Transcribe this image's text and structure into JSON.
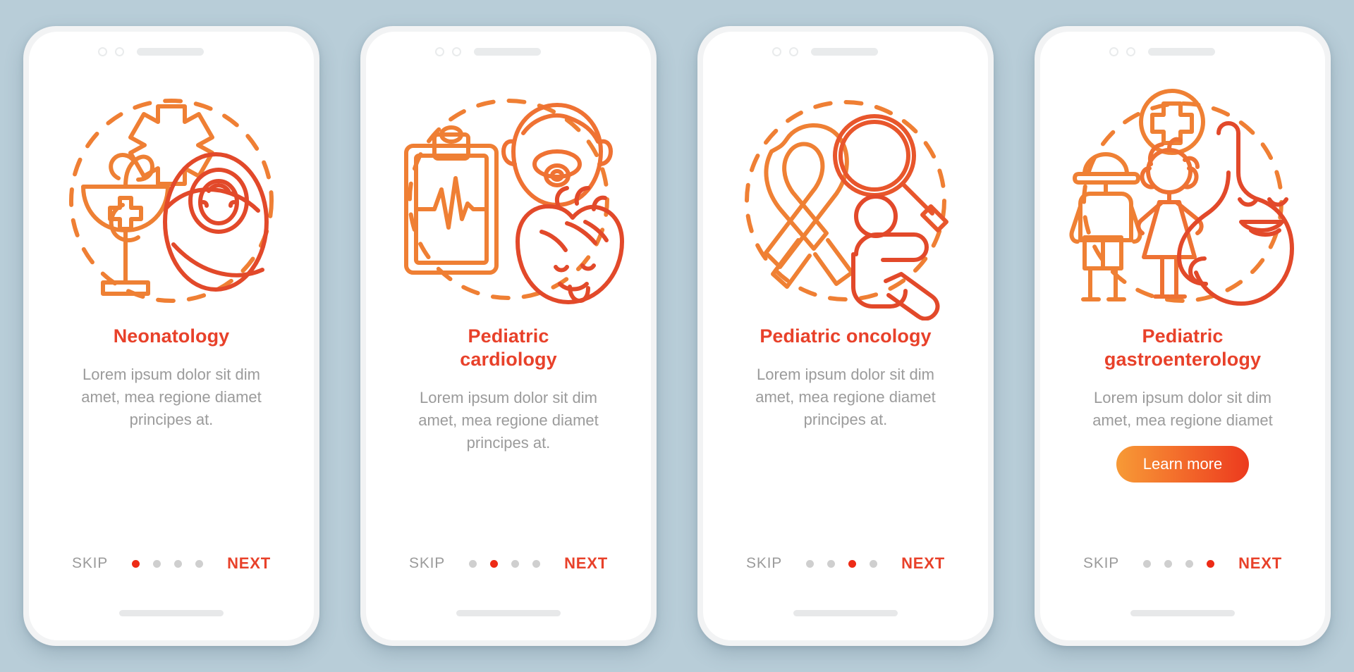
{
  "background_color": "#b8cdd8",
  "accent": {
    "title_red": "#e8412a",
    "dot_active": "#ed2b16",
    "dot_inactive": "#cfcfcf",
    "body_gray": "#9b9b9b",
    "gradient_from": "#f79a36",
    "gradient_to": "#ec3a1e"
  },
  "common": {
    "skip_label": "SKIP",
    "next_label": "NEXT",
    "description": "Lorem ipsum dolor sit dim\namet, mea regione diamet\nprincipes at.",
    "description_short": "Lorem ipsum dolor sit dim\namet, mea regione diamet",
    "total_dots": 4
  },
  "screens": [
    {
      "id": "neonatology",
      "title": "Neonatology",
      "description": "Lorem ipsum dolor sit dim\namet, mea regione diamet\nprincipes at.",
      "active_dot": 1,
      "has_cta": false,
      "cta_label": "",
      "illustration": "neonatology-icon",
      "illustration_parts": [
        "bowl-of-hygieia",
        "medical-star-of-life",
        "swaddled-baby",
        "dashed-circle"
      ]
    },
    {
      "id": "pediatric-cardiology",
      "title": "Pediatric\ncardiology",
      "description": "Lorem ipsum dolor sit dim\namet, mea regione diamet\nprincipes at.",
      "active_dot": 2,
      "has_cta": false,
      "cta_label": "",
      "illustration": "pediatric-cardiology-icon",
      "illustration_parts": [
        "clipboard-ecg",
        "baby-head-with-pacifier",
        "smiling-heart",
        "dashed-circle"
      ]
    },
    {
      "id": "pediatric-oncology",
      "title": "Pediatric oncology",
      "description": "Lorem ipsum dolor sit dim\namet, mea regione diamet\nprincipes at.",
      "active_dot": 3,
      "has_cta": false,
      "cta_label": "",
      "illustration": "pediatric-oncology-icon",
      "illustration_parts": [
        "awareness-ribbon",
        "magnifying-glass",
        "seated-child",
        "dashed-circle"
      ]
    },
    {
      "id": "pediatric-gastroenterology",
      "title": "Pediatric\ngastroenterology",
      "description": "Lorem ipsum dolor sit dim\namet, mea regione diamet",
      "active_dot": 4,
      "has_cta": true,
      "cta_label": "Learn more",
      "illustration": "pediatric-gastroenterology-icon",
      "illustration_parts": [
        "medical-cross-badge",
        "boy-and-girl",
        "smiling-stomach",
        "dashed-circle"
      ]
    }
  ]
}
